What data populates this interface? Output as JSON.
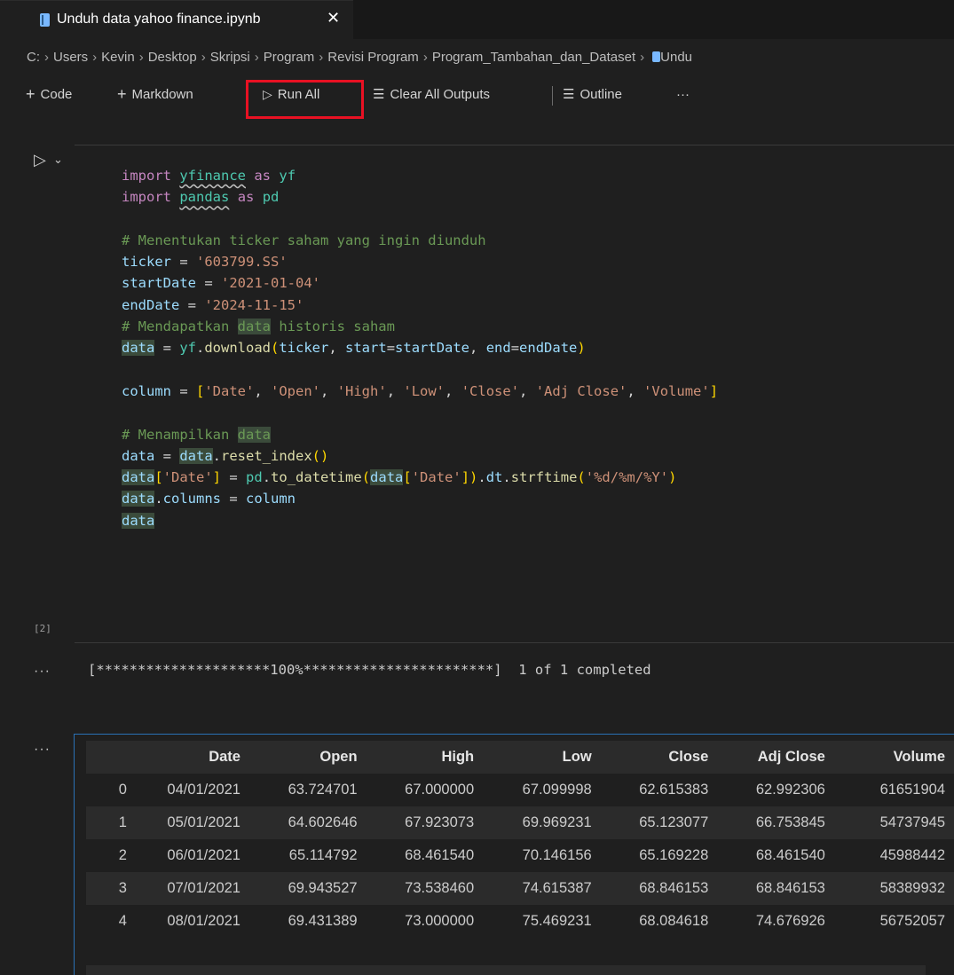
{
  "tab": {
    "title": "Unduh data yahoo finance.ipynb",
    "close": "✕"
  },
  "breadcrumb": [
    "C:",
    "Users",
    "Kevin",
    "Desktop",
    "Skripsi",
    "Program",
    "Revisi Program",
    "Program_Tambahan_dan_Dataset",
    "Undu"
  ],
  "toolbar": {
    "code": "Code",
    "markdown": "Markdown",
    "run_all": "Run All",
    "clear_outputs": "Clear All Outputs",
    "outline": "Outline",
    "more": "···"
  },
  "cell": {
    "exec_count": "[2]"
  },
  "code_lines": [
    "import yfinance as yf",
    "import pandas as pd",
    "",
    "# Menentukan ticker saham yang ingin diunduh",
    "ticker = '603799.SS'",
    "startDate = '2021-01-04'",
    "endDate = '2024-11-15'",
    "# Mendapatkan data historis saham",
    "data = yf.download(ticker, start=startDate, end=endDate)",
    "",
    "column = ['Date', 'Open', 'High', 'Low', 'Close', 'Adj Close', 'Volume']",
    "",
    "# Menampilkan data",
    "data = data.reset_index()",
    "data['Date'] = pd.to_datetime(data['Date']).dt.strftime('%d/%m/%Y')",
    "data.columns = column",
    "data"
  ],
  "output": {
    "dots": "···",
    "progress": "[*********************100%***********************]  1 of 1 completed"
  },
  "dataframe": {
    "columns": [
      "",
      "Date",
      "Open",
      "High",
      "Low",
      "Close",
      "Adj Close",
      "Volume"
    ],
    "rows": [
      [
        "0",
        "04/01/2021",
        "63.724701",
        "67.000000",
        "67.099998",
        "62.615383",
        "62.992306",
        "61651904"
      ],
      [
        "1",
        "05/01/2021",
        "64.602646",
        "67.923073",
        "69.969231",
        "65.123077",
        "66.753845",
        "54737945"
      ],
      [
        "2",
        "06/01/2021",
        "65.114792",
        "68.461540",
        "70.146156",
        "65.169228",
        "68.461540",
        "45988442"
      ],
      [
        "3",
        "07/01/2021",
        "69.943527",
        "73.538460",
        "74.615387",
        "68.846153",
        "68.846153",
        "58389932"
      ],
      [
        "4",
        "08/01/2021",
        "69.431389",
        "73.000000",
        "75.469231",
        "68.084618",
        "74.676926",
        "56752057"
      ]
    ]
  }
}
